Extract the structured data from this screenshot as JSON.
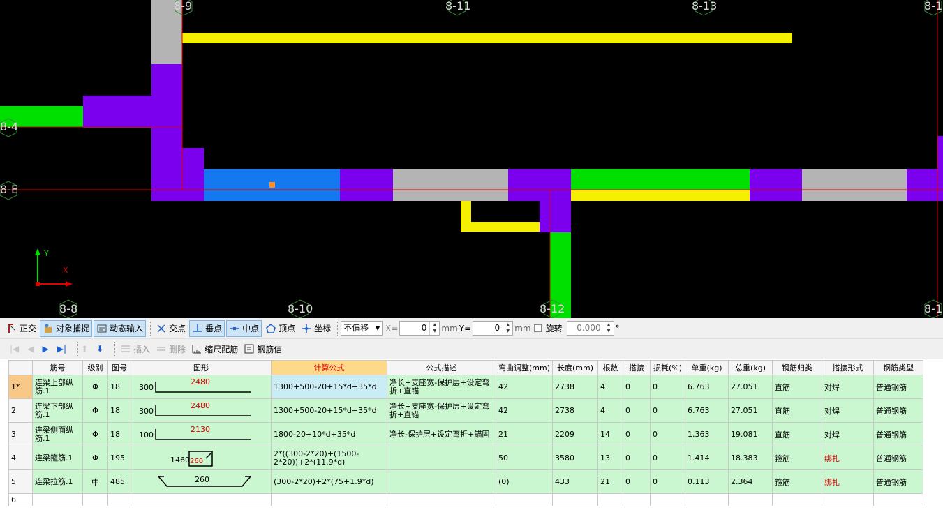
{
  "canvas": {
    "axis_labels": [
      "8-9",
      "8-11",
      "8-13",
      "8-1",
      "8-4",
      "8-E",
      "8-8",
      "8-10",
      "8-12",
      "8-1"
    ],
    "coord_x": "X",
    "coord_y": "Y"
  },
  "toolbar1": {
    "ortho": "正交",
    "snap": "对象捕捉",
    "dynamic_input": "动态输入",
    "intersection": "交点",
    "perpendicular": "垂点",
    "midpoint": "中点",
    "vertex": "顶点",
    "coordinate": "坐标",
    "offset_select": "不偏移",
    "x_label": "X=",
    "x_value": "0",
    "unit_mm_1": "mm",
    "y_label": "Y=",
    "y_value": "0",
    "unit_mm_2": "mm",
    "rotate_label": "旋转",
    "rotate_value": "0.000",
    "degree": "°"
  },
  "toolbar2": {
    "insert": "插入",
    "delete": "删除",
    "scale_rebar": "缩尺配筋",
    "rebar_info": "钢筋信"
  },
  "table": {
    "headers": [
      "筋号",
      "级别",
      "图号",
      "图形",
      "计算公式",
      "公式描述",
      "弯曲调整(mm)",
      "长度(mm)",
      "根数",
      "搭接",
      "损耗(%)",
      "单重(kg)",
      "总重(kg)",
      "钢筋归类",
      "搭接形式",
      "钢筋类型"
    ],
    "rows": [
      {
        "idx": "1*",
        "name": "连梁上部纵筋.1",
        "grade": "Φ",
        "fig": "18",
        "shape_left": "300",
        "shape_mid": "2480",
        "formula": "1300+500-20+15*d+35*d",
        "desc": "净长+支座宽-保护层+设定弯折+直锚",
        "bend": "42",
        "length": "2738",
        "count": "4",
        "lap": "0",
        "loss": "0",
        "unit_w": "6.763",
        "total_w": "27.051",
        "category": "直筋",
        "lap_type": "对焊",
        "rebar_type": "普通钢筋"
      },
      {
        "idx": "2",
        "name": "连梁下部纵筋.1",
        "grade": "Φ",
        "fig": "18",
        "shape_left": "300",
        "shape_mid": "2480",
        "formula": "1300+500-20+15*d+35*d",
        "desc": "净长+支座宽-保护层+设定弯折+直锚",
        "bend": "42",
        "length": "2738",
        "count": "4",
        "lap": "0",
        "loss": "0",
        "unit_w": "6.763",
        "total_w": "27.051",
        "category": "直筋",
        "lap_type": "对焊",
        "rebar_type": "普通钢筋"
      },
      {
        "idx": "3",
        "name": "连梁侧面纵筋.1",
        "grade": "Φ",
        "fig": "18",
        "shape_left": "100",
        "shape_mid": "2130",
        "formula": "1800-20+10*d+35*d",
        "desc": "净长-保护层+设定弯折+锚固",
        "bend": "21",
        "length": "2209",
        "count": "14",
        "lap": "0",
        "loss": "0",
        "unit_w": "1.363",
        "total_w": "19.081",
        "category": "直筋",
        "lap_type": "对焊",
        "rebar_type": "普通钢筋"
      },
      {
        "idx": "4",
        "name": "连梁箍筋.1",
        "grade": "Φ",
        "fig": "195",
        "shape_left": "1460",
        "shape_mid": "260",
        "formula": "2*((300-2*20)+(1500-2*20))+2*(11.9*d)",
        "desc": "",
        "bend": "50",
        "length": "3580",
        "count": "13",
        "lap": "0",
        "loss": "0",
        "unit_w": "1.414",
        "total_w": "18.383",
        "category": "箍筋",
        "lap_type": "绑扎",
        "rebar_type": "普通钢筋"
      },
      {
        "idx": "5",
        "name": "连梁拉筋.1",
        "grade": "中",
        "fig": "485",
        "shape_left": "",
        "shape_mid": "260",
        "formula": "(300-2*20)+2*(75+1.9*d)",
        "desc": "",
        "bend": "(0)",
        "length": "433",
        "count": "21",
        "lap": "0",
        "loss": "0",
        "unit_w": "0.113",
        "total_w": "2.364",
        "category": "箍筋",
        "lap_type": "绑扎",
        "rebar_type": "普通钢筋"
      },
      {
        "idx": "6",
        "name": "",
        "grade": "",
        "fig": "",
        "shape_left": "",
        "shape_mid": "",
        "formula": "",
        "desc": "",
        "bend": "",
        "length": "",
        "count": "",
        "lap": "",
        "loss": "",
        "unit_w": "",
        "total_w": "",
        "category": "",
        "lap_type": "",
        "rebar_type": ""
      }
    ]
  },
  "colors": {
    "canvas_bg": "#000000",
    "yellow": "#f5f000",
    "purple": "#7a00ee",
    "green": "#00e000",
    "blue": "#1478f0",
    "gray": "#b4b4b4",
    "grid_red": "#e00000",
    "row_green": "#caf7d0",
    "header_hl": "#ffd98a"
  }
}
